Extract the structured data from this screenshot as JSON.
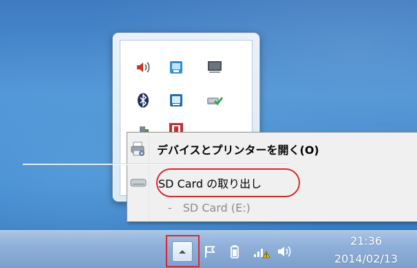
{
  "context_menu": {
    "open_devices_label": "デバイスとプリンターを開く(O)",
    "eject_label": "SD Card の取り出し",
    "sub_item_label": "-　SD Card (E:)"
  },
  "taskbar": {
    "time": "21:36",
    "date": "2014/02/13"
  },
  "flyout_icons": [
    "speaker-icon",
    "screen-capture-icon",
    "display-icon",
    "bluetooth-icon",
    "tablet-icon",
    "network-check-icon",
    "usb-device-icon",
    "media-app-icon"
  ],
  "taskbar_icons": [
    "show-hidden-icons-arrow",
    "flag-icon",
    "battery-icon",
    "network-warning-icon",
    "volume-icon"
  ],
  "colors": {
    "highlight": "#d3282e",
    "desktop": "#4d92d4",
    "taskbar": "#8fb0d9"
  }
}
